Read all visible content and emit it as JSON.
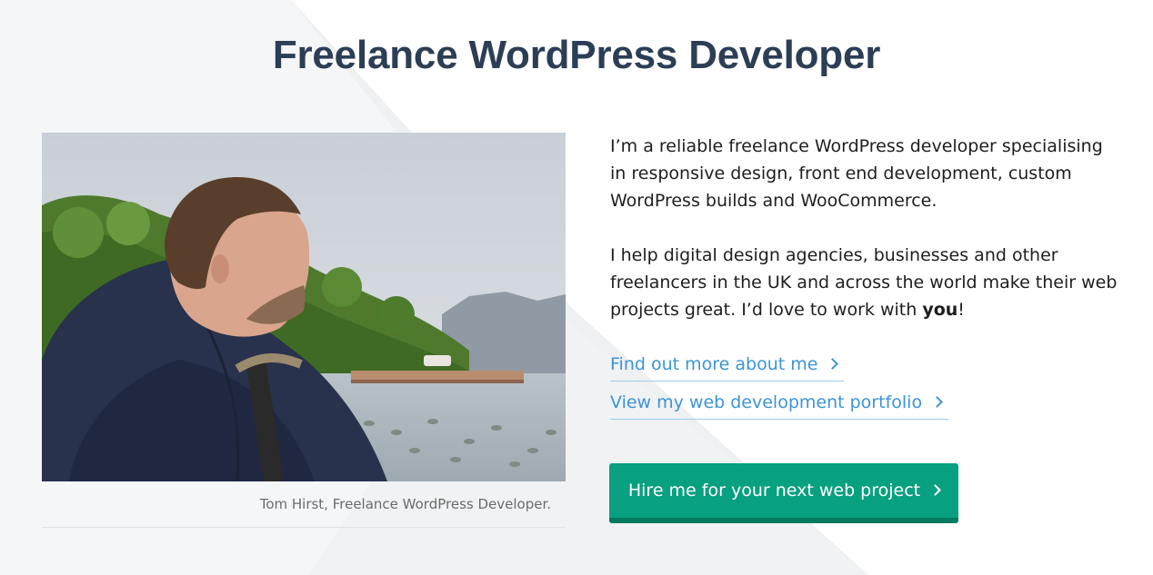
{
  "page_title": "Freelance WordPress Developer",
  "photo": {
    "icon": "portrait-photo",
    "caption": "Tom Hirst, Freelance WordPress Developer."
  },
  "intro": {
    "paragraph1": "I’m a reliable freelance WordPress developer specialising in responsive design, front end development, custom WordPress builds and WooCommerce.",
    "paragraph2_text": "I help digital design agencies, businesses and other freelancers in the UK and across the world make their web projects great. I’d love to work with ",
    "paragraph2_emphasis": "you",
    "paragraph2_end": "!"
  },
  "links": {
    "about": "Find out more about me",
    "portfolio": "View my web development portfolio"
  },
  "cta": {
    "label": "Hire me for your next web project"
  },
  "colors": {
    "title": "#2c3e55",
    "link": "#3d95d4",
    "button": "#07a080",
    "button_shadow": "#047a61",
    "background_shape": "#f3f4f6"
  },
  "icons": {
    "link_chevron": "chevron-right-icon",
    "button_chevron": "chevron-right-icon"
  }
}
